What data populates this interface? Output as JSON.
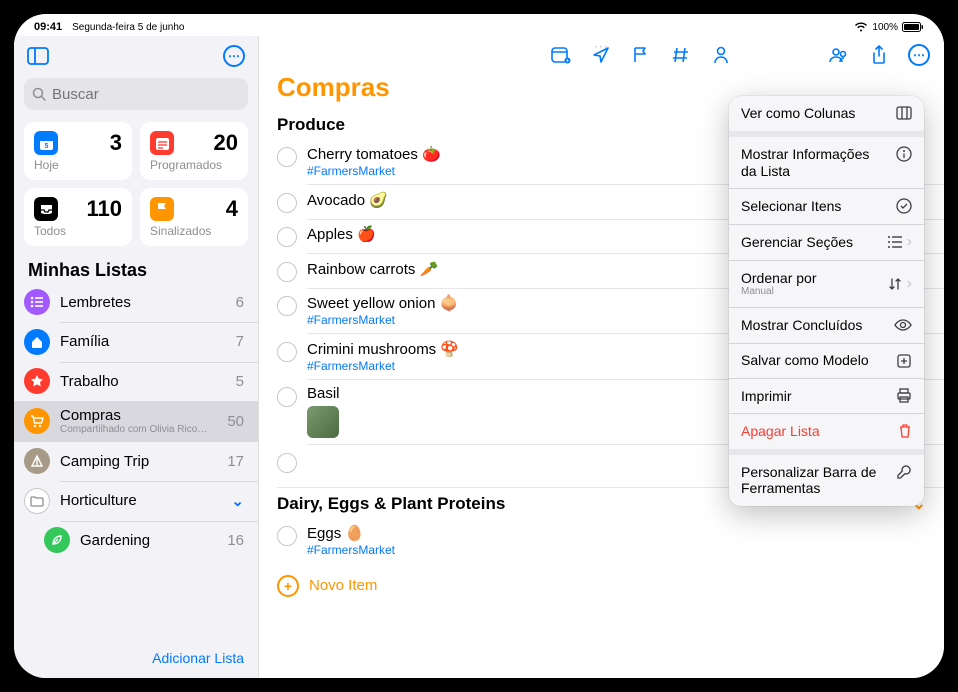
{
  "status": {
    "time": "09:41",
    "date": "Segunda-feira 5 de junho",
    "battery": "100%"
  },
  "search": {
    "placeholder": "Buscar"
  },
  "smart": [
    {
      "label": "Hoje",
      "count": "3",
      "color": "#007aff",
      "icon": "calendar"
    },
    {
      "label": "Programados",
      "count": "20",
      "color": "#ff3b30",
      "icon": "calendar-lines"
    },
    {
      "label": "Todos",
      "count": "110",
      "color": "#000000",
      "icon": "inbox"
    },
    {
      "label": "Sinalizados",
      "count": "4",
      "color": "#ff9500",
      "icon": "flag"
    }
  ],
  "lists_header": "Minhas Listas",
  "lists": [
    {
      "name": "Lembretes",
      "count": "6",
      "color": "#a259ff",
      "icon": "list"
    },
    {
      "name": "Família",
      "count": "7",
      "color": "#007aff",
      "icon": "house"
    },
    {
      "name": "Trabalho",
      "count": "5",
      "color": "#ff3b30",
      "icon": "star"
    },
    {
      "name": "Compras",
      "count": "50",
      "color": "#ff9500",
      "icon": "cart",
      "sub": "Compartilhado com Olivia Rico…",
      "selected": true
    },
    {
      "name": "Camping Trip",
      "count": "17",
      "color": "#a79a87",
      "icon": "tent"
    },
    {
      "name": "Horticulture",
      "count": "",
      "folder": true
    },
    {
      "name": "Gardening",
      "count": "16",
      "color": "#34c759",
      "icon": "leaf",
      "indent": true
    }
  ],
  "sidebar_footer": "Adicionar Lista",
  "main": {
    "title": "Compras",
    "sections": [
      {
        "title": "Produce",
        "items": [
          {
            "text": "Cherry tomatoes 🍅",
            "tag": "#FarmersMarket"
          },
          {
            "text": "Avocado 🥑"
          },
          {
            "text": "Apples 🍎"
          },
          {
            "text": "Rainbow carrots 🥕"
          },
          {
            "text": "Sweet yellow onion 🧅",
            "tag": "#FarmersMarket"
          },
          {
            "text": "Crimini mushrooms 🍄",
            "tag": "#FarmersMarket"
          },
          {
            "text": "Basil",
            "thumb": true
          },
          {
            "text": "",
            "empty": true
          }
        ]
      },
      {
        "title": "Dairy, Eggs & Plant Proteins",
        "collapsible": true,
        "items": [
          {
            "text": "Eggs 🥚",
            "tag": "#FarmersMarket"
          }
        ]
      }
    ],
    "new_item": "Novo Item"
  },
  "popover": [
    {
      "label": "Ver como Colunas",
      "icon": "columns"
    },
    {
      "gap": true
    },
    {
      "label": "Mostrar Informações da Lista",
      "icon": "info",
      "tall": true
    },
    {
      "sep": true
    },
    {
      "label": "Selecionar Itens",
      "icon": "select"
    },
    {
      "sep": true
    },
    {
      "label": "Gerenciar Seções",
      "icon": "sections",
      "chev": true
    },
    {
      "sep": true
    },
    {
      "label": "Ordenar por",
      "sub": "Manual",
      "icon": "sort",
      "chev": true
    },
    {
      "sep": true
    },
    {
      "label": "Mostrar Concluídos",
      "icon": "eye"
    },
    {
      "sep": true
    },
    {
      "label": "Salvar como Modelo",
      "icon": "template"
    },
    {
      "sep": true
    },
    {
      "label": "Imprimir",
      "icon": "print"
    },
    {
      "sep": true
    },
    {
      "label": "Apagar Lista",
      "icon": "trash",
      "danger": true
    },
    {
      "gap": true
    },
    {
      "label": "Personalizar Barra de Ferramentas",
      "icon": "wrench",
      "tall": true
    }
  ]
}
